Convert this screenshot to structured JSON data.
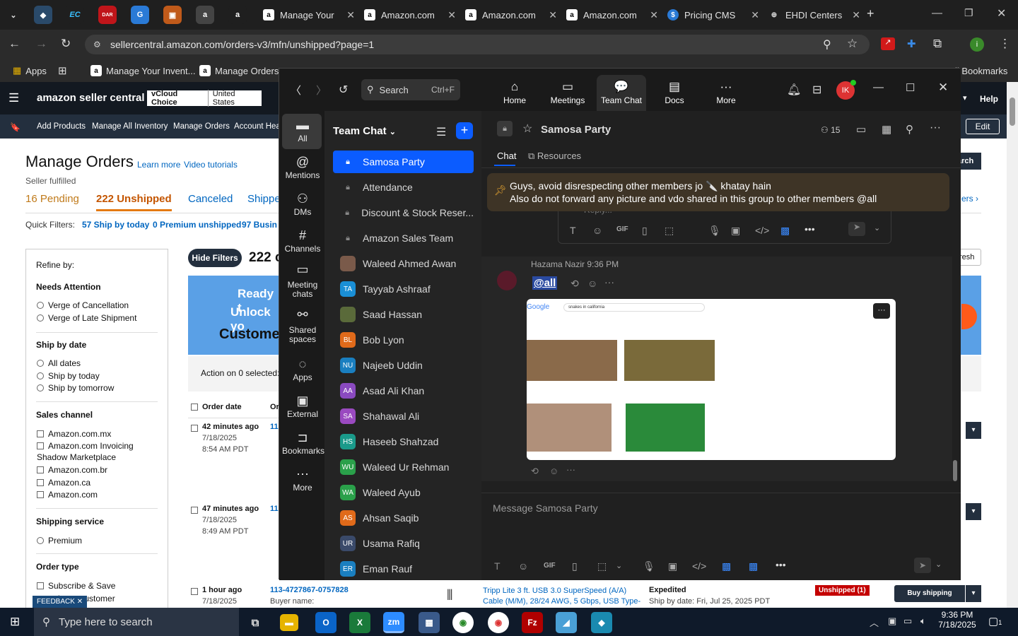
{
  "browser": {
    "tabs": [
      {
        "label": "Manage Your"
      },
      {
        "label": "Amazon.com"
      },
      {
        "label": "Amazon.com"
      },
      {
        "label": "Amazon.com"
      },
      {
        "label": "Pricing CMS"
      },
      {
        "label": "EHDI Centers"
      }
    ],
    "url": "sellercentral.amazon.com/orders-v3/mfn/unshipped?page=1",
    "bookmarks": [
      "Apps",
      "Manage Your Invent...",
      "Manage Orders"
    ],
    "all_bookmarks": "All Bookmarks",
    "pinned_labels": [
      "EC",
      "DAR"
    ]
  },
  "amazon": {
    "logo": "amazon seller central",
    "store": "vCloud Choice",
    "country": "United States",
    "help": "Help",
    "nav": [
      "Add Products",
      "Manage All Inventory",
      "Manage Orders",
      "Account Heal"
    ],
    "edit": "Edit",
    "title": "Manage Orders",
    "learn_more": "Learn more",
    "video_tutorials": "Video tutorials",
    "seller_fulfilled": "Seller fulfilled",
    "tabs": [
      "16 Pending",
      "222 Unshipped",
      "Canceled",
      "Shippe"
    ],
    "quick_filters_label": "Quick Filters:",
    "quick_filters": [
      "57 Ship by today",
      "0 Premium unshipped",
      "97 Busin"
    ],
    "refine": {
      "title": "Refine by:",
      "needs_attention": "Needs Attention",
      "na_items": [
        "Verge of Cancellation",
        "Verge of Late Shipment"
      ],
      "ship_by_date": "Ship by date",
      "sbd_items": [
        "All dates",
        "Ship by today",
        "Ship by tomorrow"
      ],
      "sales_channel": "Sales channel",
      "sc_items": [
        "Amazon.com.mx",
        "Amazon.com Invoicing",
        "Shadow Marketplace",
        "Amazon.com.br",
        "Amazon.ca",
        "Amazon.com"
      ],
      "shipping_service": "Shipping service",
      "ss_items": [
        "Premium"
      ],
      "order_type": "Order type",
      "ot_items": [
        "Subscribe & Save",
        "iness customer"
      ]
    },
    "hide_filters": "Hide Filters",
    "count": "222 c",
    "banner": [
      "Ready t",
      "Unlock yo",
      "Custome"
    ],
    "action_on": "Action on 0 selected:",
    "col_order_date": "Order date",
    "col_or": "Or",
    "orders": [
      {
        "age": "42 minutes ago",
        "date": "7/18/2025",
        "time": "8:54 AM PDT",
        "id": "11"
      },
      {
        "age": "47 minutes ago",
        "date": "7/18/2025",
        "time": "8:49 AM PDT",
        "id": "11"
      },
      {
        "age": "1 hour ago",
        "date": "7/18/2025",
        "id": "113-4727867-0757828",
        "buyer": "Buyer name:",
        "product": "Tripp Lite 3 ft. USB 3.0 SuperSpeed (A/A) Cable (M/M), 28/24 AWG, 5 Gbps, USB Type-A to Type-A,",
        "service": "Expedited",
        "ship_by": "Ship by date: Fri, Jul 25, 2025 PDT",
        "status": "Unshipped (1)",
        "buy_shipping": "Buy shipping"
      }
    ],
    "search_fragment": "arch",
    "ers_fragment": "ers",
    "refresh_fragment": "resh",
    "feedback": "FEEDBACK"
  },
  "zoom": {
    "search": "Search",
    "shortcut": "Ctrl+F",
    "top_tabs": [
      "Home",
      "Meetings",
      "Team Chat",
      "Docs",
      "More"
    ],
    "avatar": "IK",
    "rail": [
      "All",
      "Mentions",
      "DMs",
      "Channels",
      "Meeting chats",
      "Shared spaces",
      "Apps",
      "External",
      "Bookmarks",
      "More"
    ],
    "list_title": "Team Chat",
    "channels": [
      {
        "name": "Samosa Party",
        "type": "lock"
      },
      {
        "name": "Attendance",
        "type": "lock"
      },
      {
        "name": "Discount & Stock Reser...",
        "type": "lock"
      },
      {
        "name": "Amazon Sales Team",
        "type": "lock"
      },
      {
        "name": "Waleed Ahmed Awan",
        "type": "photo",
        "color": "#7a5a4a"
      },
      {
        "name": "Tayyab Ashraaf",
        "type": "TA",
        "color": "#1a8fd6"
      },
      {
        "name": "Saad Hassan",
        "type": "photo",
        "color": "#5a6a3a"
      },
      {
        "name": "Bob Lyon",
        "type": "BL",
        "color": "#e06a1a"
      },
      {
        "name": "Najeeb Uddin",
        "type": "NU",
        "color": "#1a7fc0"
      },
      {
        "name": "Asad Ali Khan",
        "type": "AA",
        "color": "#8a4ac0"
      },
      {
        "name": "Shahawal Ali",
        "type": "SA",
        "color": "#9a4ac0"
      },
      {
        "name": "Haseeb Shahzad",
        "type": "HS",
        "color": "#1a9a8a"
      },
      {
        "name": "Waleed Ur Rehman",
        "type": "WU",
        "color": "#2aa04a"
      },
      {
        "name": "Waleed Ayub",
        "type": "WA",
        "color": "#2aa04a"
      },
      {
        "name": "Ahsan Saqib",
        "type": "AS",
        "color": "#e06a1a"
      },
      {
        "name": "Usama Rafiq",
        "type": "UR",
        "color": "#3a4a6a"
      },
      {
        "name": "Eman Rauf",
        "type": "ER",
        "color": "#1a7fc0"
      }
    ],
    "chat": {
      "title": "Samosa Party",
      "members": "15",
      "tab_chat": "Chat",
      "tab_resources": "Resources",
      "pinned_line1": "Guys, avoid disrespecting other members jo 🔪 khatay hain",
      "pinned_line2": "Also do not forward any picture and vdo shared in this group to other members @all",
      "reply_placeholder": "Reply...",
      "sender": "Hazama Nazir",
      "time": "9:36 PM",
      "message": "@all",
      "image_search": "snakes in california",
      "image_brand": "Google",
      "composer_placeholder": "Message Samosa Party"
    }
  },
  "taskbar": {
    "search": "Type here to search",
    "time": "9:36 PM",
    "date": "7/18/2025",
    "notif_count": "1"
  }
}
